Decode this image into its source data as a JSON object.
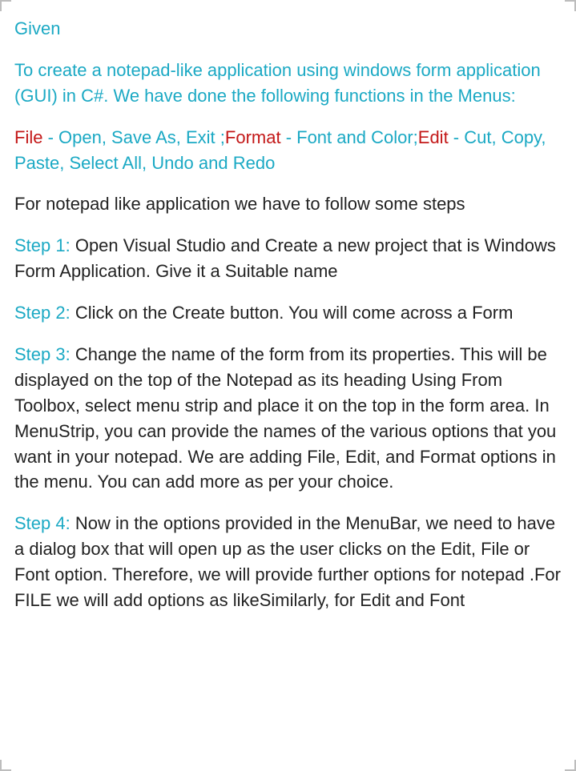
{
  "heading": "Given",
  "intro": "To create a notepad-like application using windows form application (GUI) in C#. We have done the following functions in the Menus:",
  "menus": {
    "file_label": "File",
    "file_rest": " - Open, Save As, Exit ;",
    "format_label": "Format",
    "format_rest": " - Font and Color;",
    "edit_label": "Edit",
    "edit_rest": " - Cut, Copy, Paste, Select All, Undo and Redo"
  },
  "follow": "For notepad like application we have to follow some steps",
  "steps": {
    "s1_label": "Step 1:",
    "s1_text": " Open Visual Studio and Create a new project that is Windows Form Application. Give it a Suitable name",
    "s2_label": "Step 2:",
    "s2_text": " Click on the Create button. You will come across a Form",
    "s3_label": "Step 3:",
    "s3_text": " Change the name of the form from its properties. This will be displayed on the top of the Notepad as its heading Using From Toolbox, select menu strip and place it on the top in the form area. In MenuStrip, you can provide the names of the various options that you want in your notepad. We are adding File, Edit, and Format options in the menu. You can add more as per your choice.",
    "s4_label": "Step 4:",
    "s4_text": "  Now in the options provided in the MenuBar, we need to have a dialog box that will open up as the user clicks on the  Edit, File or Font option. Therefore, we will provide further options for notepad .For FILE we will add options as likeSimilarly, for Edit and Font"
  }
}
